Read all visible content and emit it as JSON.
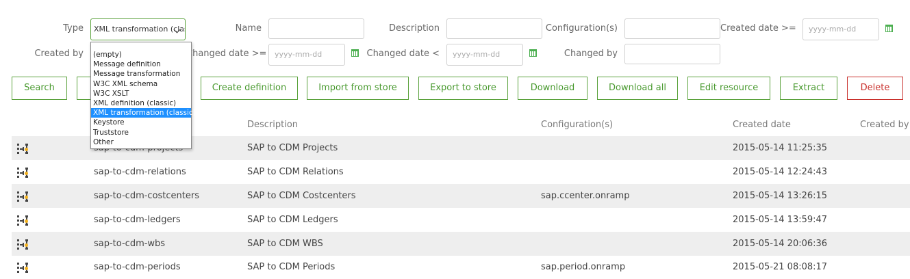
{
  "filters": {
    "type_label": "Type",
    "type_value": "XML transformation (classi",
    "type_options": [
      "(empty)",
      "Message definition",
      "Message transformation",
      "W3C XML schema",
      "W3C XSLT",
      "XML definition (classic)",
      "XML transformation (classic)",
      "Keystore",
      "Truststore",
      "Other"
    ],
    "type_selected_index": 6,
    "name_label": "Name",
    "description_label": "Description",
    "configurations_label": "Configuration(s)",
    "created_date_label": "Created date >=",
    "created_date_placeholder": "yyyy-mm-dd",
    "created_by_label": "Created by",
    "changed_date_ge_label": "Changed date >=",
    "changed_date_ge_placeholder": "yyyy-mm-dd",
    "changed_date_lt_label": "Changed date <",
    "changed_date_lt_placeholder": "yyyy-mm-dd",
    "changed_by_label": "Changed by"
  },
  "toolbar": {
    "search": "Search",
    "create_definition": "Create definition",
    "import_from_store": "Import from store",
    "export_to_store": "Export to store",
    "download": "Download",
    "download_all": "Download all",
    "edit_resource": "Edit resource",
    "extract": "Extract",
    "delete": "Delete"
  },
  "colors": {
    "accent_green": "#5aa23c",
    "danger_red": "#c9302c",
    "selected_blue": "#1e90ff"
  },
  "table": {
    "columns": [
      "Description",
      "Configuration(s)",
      "Created date",
      "Created by"
    ],
    "rows": [
      {
        "name": "sap-to-cdm-projects",
        "description": "SAP to CDM Projects",
        "configurations": "",
        "created_date": "2015-05-14 11:25:35",
        "created_by": ""
      },
      {
        "name": "sap-to-cdm-relations",
        "description": "SAP to CDM Relations",
        "configurations": "",
        "created_date": "2015-05-14 12:24:43",
        "created_by": ""
      },
      {
        "name": "sap-to-cdm-costcenters",
        "description": "SAP to CDM Costcenters",
        "configurations": "sap.ccenter.onramp",
        "created_date": "2015-05-14 13:26:15",
        "created_by": ""
      },
      {
        "name": "sap-to-cdm-ledgers",
        "description": "SAP to CDM Ledgers",
        "configurations": "",
        "created_date": "2015-05-14 13:59:47",
        "created_by": ""
      },
      {
        "name": "sap-to-cdm-wbs",
        "description": "SAP to CDM WBS",
        "configurations": "",
        "created_date": "2015-05-14 20:06:36",
        "created_by": ""
      },
      {
        "name": "sap-to-cdm-periods",
        "description": "SAP to CDM Periods",
        "configurations": "sap.period.onramp",
        "created_date": "2015-05-21 08:08:17",
        "created_by": ""
      }
    ]
  }
}
